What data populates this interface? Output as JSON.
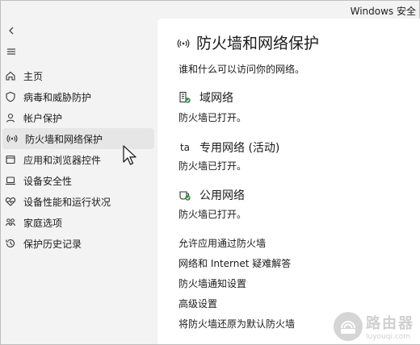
{
  "window": {
    "title": "Windows 安全"
  },
  "sidebar": {
    "items": [
      {
        "label": "主页",
        "icon": "home-icon"
      },
      {
        "label": "病毒和威胁防护",
        "icon": "shield-icon"
      },
      {
        "label": "帐户保护",
        "icon": "person-icon"
      },
      {
        "label": "防火墙和网络保护",
        "icon": "wifi-antenna-icon"
      },
      {
        "label": "应用和浏览器控件",
        "icon": "app-window-icon"
      },
      {
        "label": "设备安全性",
        "icon": "laptop-icon"
      },
      {
        "label": "设备性能和运行状况",
        "icon": "heart-pulse-icon"
      },
      {
        "label": "家庭选项",
        "icon": "family-icon"
      },
      {
        "label": "保护历史记录",
        "icon": "history-icon"
      }
    ],
    "active_index": 3
  },
  "main": {
    "title": "防火墙和网络保护",
    "description": "谁和什么可以访问你的网络。",
    "networks": [
      {
        "name": "域网络",
        "status": "防火墙已打开。",
        "icon": "domain-network-icon"
      },
      {
        "name": "专用网络 (活动)",
        "status": "防火墙已打开。",
        "icon": "private-network-icon"
      },
      {
        "name": "公用网络",
        "status": "防火墙已打开。",
        "icon": "public-network-icon"
      }
    ],
    "links": [
      "允许应用通过防火墙",
      "网络和 Internet 疑难解答",
      "防火墙通知设置",
      "高级设置",
      "将防火墙还原为默认防火墙"
    ]
  },
  "watermark": {
    "title": "路由器",
    "subtitle": "luyouqi.com"
  }
}
